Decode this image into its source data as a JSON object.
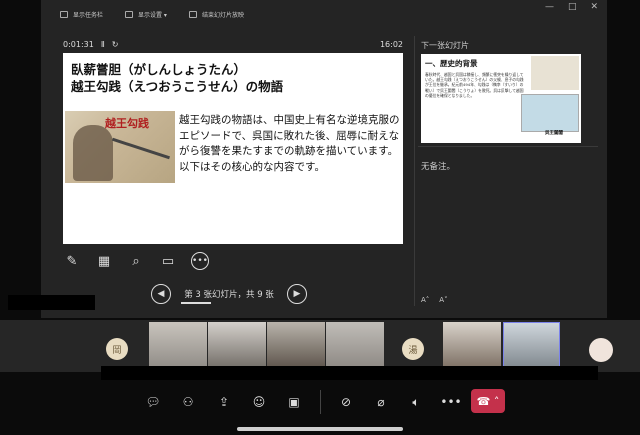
{
  "presenter": {
    "toolbar": {
      "show_taskbar": "显示任务栏",
      "display_settings": "显示设置 ▾",
      "end_show": "结束幻灯片放映"
    },
    "window_controls": {
      "minimize": "—",
      "maximize": "□",
      "close": "✕"
    },
    "elapsed": "0:01:31",
    "pause_icon": "Ⅱ",
    "reset_icon": "↻",
    "clock": "16:02",
    "next_slide_label": "下一张幻灯片",
    "notes_text": "无备注。",
    "nav_label": "第 3 张幻灯片，共 9 张",
    "font_increase": "A˄",
    "font_decrease": "A˅"
  },
  "slide": {
    "title_line1": "臥薪嘗胆（がしんしょうたん）",
    "title_line2": "越王勾践（えつおうこうせん）の物語",
    "image_caption": "越王勾践",
    "body": "越王勾践の物語は、中国史上有名な逆境克服のエピソードで、呉国に敗れた後、屈辱に耐えながら復讐を果たすまでの軌跡を描いています。以下はその核心的な内容です。"
  },
  "next_slide": {
    "title": "一、歴史的背景",
    "text": "春秋時代、越国と呉国は隣接し、頻繁に衝突を繰り返していた。越王勾践（えつおうこうせん）の父親、息子の勾践が王位を継承。紀元前494年、勾践は（檇李（すいり）の戦い）で呉王闔閭（こうりょ）を敗死。呉は反撃して越国の優位を確保となりました。",
    "map_caption": "呉王闔閭"
  },
  "participants": [
    {
      "initial": "岡",
      "color": "#e8dcc2"
    },
    {
      "initial": "湯",
      "color": "#e8dcc2"
    }
  ],
  "controls": {
    "chat_icon": "chat-icon",
    "people_icon": "people-icon",
    "share_icon": "share-icon",
    "reactions_icon": "reactions-icon",
    "apps_icon": "apps-icon",
    "camera_icon": "camera-off-icon",
    "mic_icon": "mic-off-icon",
    "speaker_icon": "speaker-icon",
    "more_icon": "more-icon",
    "end_call_icon": "end-call-icon"
  },
  "colors": {
    "end_call": "#c4314b",
    "slide_bg": "#ffffff",
    "panel_bg": "#242424"
  }
}
